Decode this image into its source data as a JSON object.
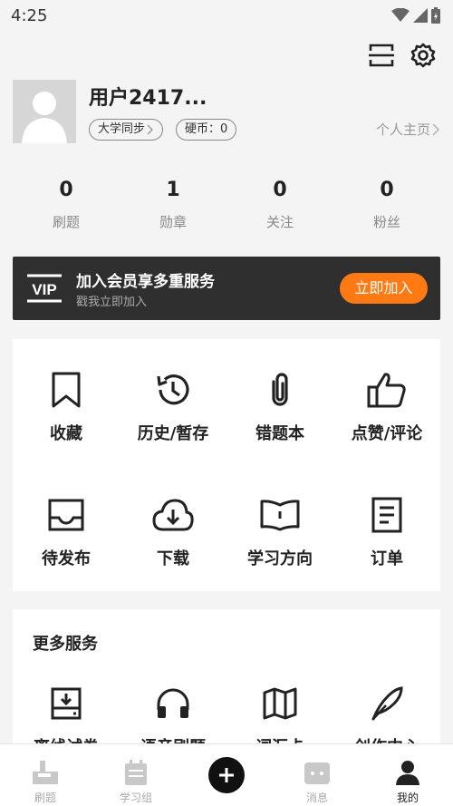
{
  "status": {
    "time": "4:25"
  },
  "profile": {
    "username": "用户2417...",
    "chips": [
      {
        "label": "大学同步",
        "has_chevron": true
      },
      {
        "label": "硬币：0",
        "has_chevron": false
      }
    ],
    "homepage_label": "个人主页"
  },
  "stats": [
    {
      "value": "0",
      "label": "刷题"
    },
    {
      "value": "1",
      "label": "勋章"
    },
    {
      "value": "0",
      "label": "关注"
    },
    {
      "value": "0",
      "label": "粉丝"
    }
  ],
  "vip": {
    "logo_text": "VIP",
    "title": "加入会员享多重服务",
    "subtitle": "戳我立即加入",
    "button_label": "立即加入",
    "accent_color": "#ff7a13"
  },
  "features": [
    {
      "label": "收藏",
      "icon": "bookmark-icon"
    },
    {
      "label": "历史/暂存",
      "icon": "history-icon"
    },
    {
      "label": "错题本",
      "icon": "paperclip-icon"
    },
    {
      "label": "点赞/评论",
      "icon": "thumbs-up-icon"
    },
    {
      "label": "待发布",
      "icon": "inbox-icon"
    },
    {
      "label": "下载",
      "icon": "cloud-download-icon"
    },
    {
      "label": "学习方向",
      "icon": "open-book-icon"
    },
    {
      "label": "订单",
      "icon": "order-icon"
    }
  ],
  "more_services": {
    "title": "更多服务",
    "items": [
      {
        "label": "离线试卷",
        "icon": "offline-download-icon"
      },
      {
        "label": "语音刷题",
        "icon": "headphones-icon"
      },
      {
        "label": "词汇卡",
        "icon": "map-icon"
      },
      {
        "label": "创作中心",
        "icon": "feather-icon"
      }
    ]
  },
  "tabs": [
    {
      "label": "刷题",
      "icon": "practice-icon"
    },
    {
      "label": "学习组",
      "icon": "calendar-icon"
    },
    {
      "label": "",
      "icon": "plus-icon"
    },
    {
      "label": "消息",
      "icon": "message-icon"
    },
    {
      "label": "我的",
      "icon": "person-icon",
      "active": true
    }
  ]
}
